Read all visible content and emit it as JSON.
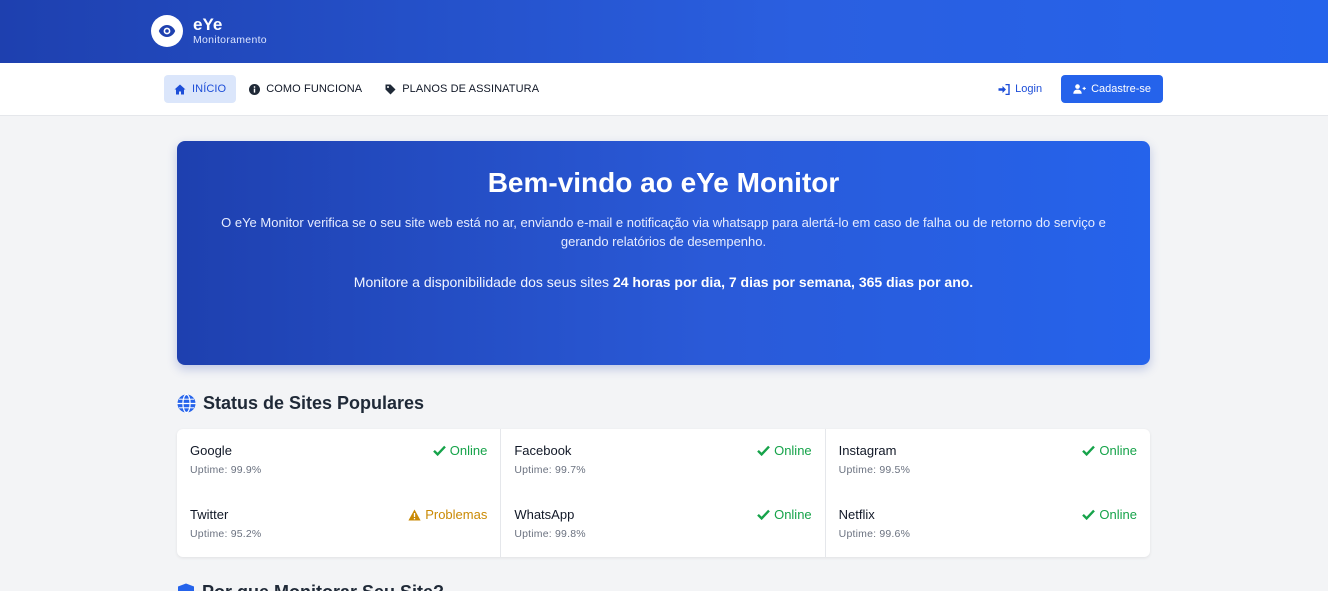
{
  "brand": {
    "name": "eYe",
    "subtitle": "Monitoramento",
    "logo_icon": "eye-icon"
  },
  "nav": {
    "items": [
      {
        "label": "INÍCIO",
        "icon": "home-icon",
        "active": true
      },
      {
        "label": "COMO FUNCIONA",
        "icon": "info-circle-icon",
        "active": false
      },
      {
        "label": "PLANOS DE ASSINATURA",
        "icon": "tag-icon",
        "active": false
      }
    ],
    "login_label": "Login",
    "signup_label": "Cadastre-se"
  },
  "hero": {
    "title": "Bem-vindo ao eYe Monitor",
    "description": "O eYe Monitor verifica se o seu site web está no ar, enviando e-mail e notificação via whatsapp para alertá-lo em caso de falha ou de retorno do serviço e gerando relatórios de desempenho.",
    "availability_prefix": "Monitore a disponibilidade dos seus sites ",
    "availability_bold": "24 horas por dia, 7 dias por semana, 365 dias por ano."
  },
  "status_section": {
    "title": "Status de Sites Populares",
    "icon": "globe-icon",
    "sites": [
      {
        "name": "Google",
        "uptime": "Uptime: 99.9%",
        "status": "Online",
        "state": "online"
      },
      {
        "name": "Facebook",
        "uptime": "Uptime: 99.7%",
        "status": "Online",
        "state": "online"
      },
      {
        "name": "Instagram",
        "uptime": "Uptime: 99.5%",
        "status": "Online",
        "state": "online"
      },
      {
        "name": "Twitter",
        "uptime": "Uptime: 95.2%",
        "status": "Problemas",
        "state": "warn"
      },
      {
        "name": "WhatsApp",
        "uptime": "Uptime: 99.8%",
        "status": "Online",
        "state": "online"
      },
      {
        "name": "Netflix",
        "uptime": "Uptime: 99.6%",
        "status": "Online",
        "state": "online"
      }
    ]
  },
  "next_section": {
    "title": "Por que Monitorar Seu Site?",
    "icon": "shield-icon"
  },
  "colors": {
    "primary": "#2563eb",
    "primary_dark": "#1e40af",
    "online": "#16a34a",
    "warning": "#ca8a04"
  }
}
